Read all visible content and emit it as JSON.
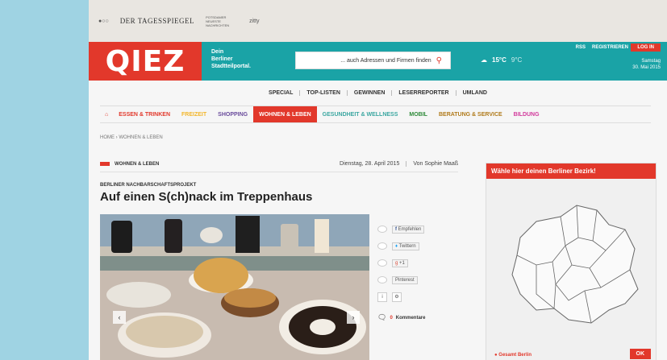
{
  "topbar": {
    "logo1": "DER TAGESSPIEGEL",
    "logo2": "POTSDAMER NEUESTE NACHRICHTEN",
    "logo3": "zitty"
  },
  "header": {
    "logo": "QIEZ",
    "tagline": "Dein\nBerliner\nStadtteilportal.",
    "search_placeholder": "... auch Adressen und Firmen finden",
    "weather_temp": "15°C",
    "weather_temp2": "9°C",
    "links": [
      "RSS",
      "REGISTRIEREN"
    ],
    "login": "LOG IN",
    "date": "Samstag\n30. Mai 2015"
  },
  "subnav": [
    "SPECIAL",
    "TOP-LISTEN",
    "GEWINNEN",
    "LESERREPORTER",
    "UMLAND"
  ],
  "mainnav": [
    {
      "label": "ESSEN & TRINKEN",
      "color": "#e2382b"
    },
    {
      "label": "FREIZEIT",
      "color": "#f3b62a"
    },
    {
      "label": "SHOPPING",
      "color": "#6a4c9c"
    },
    {
      "label": "WOHNEN & LEBEN",
      "color": "#ffffff"
    },
    {
      "label": "GESUNDHEIT & WELLNESS",
      "color": "#3aa6a0"
    },
    {
      "label": "MOBIL",
      "color": "#2f8b3a"
    },
    {
      "label": "BERATUNG & SERVICE",
      "color": "#b07a1a"
    },
    {
      "label": "BILDUNG",
      "color": "#d23a9c"
    }
  ],
  "breadcrumb": "HOME  ›  WOHNEN & LEBEN",
  "article": {
    "section": "WOHNEN & LEBEN",
    "date": "Dienstag, 28. April 2015",
    "author": "Von Sophie Maaß",
    "kicker": "BERLINER NACHBARSCHAFTSPROJEKT",
    "headline": "Auf einen S(ch)nack im Treppenhaus"
  },
  "social": {
    "facebook": "Empfehlen",
    "twitter": "Twittern",
    "gplus": "+1",
    "pinterest": "Pinterest",
    "comments_count": "0",
    "comments_label": "Kommentare"
  },
  "sidebar": {
    "title": "Wähle hier deinen Berliner Bezirk!",
    "bottom_link": "Gesamt Berlin",
    "ok": "OK"
  }
}
